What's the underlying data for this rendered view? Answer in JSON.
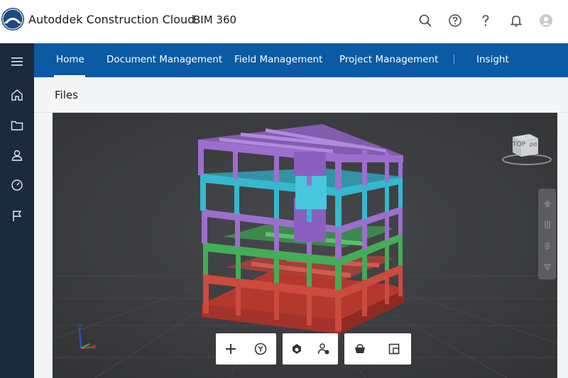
{
  "header": {
    "brand": "Autoddek Construction Cloud",
    "product": "BIM 360",
    "icons": [
      "search-icon",
      "help-circle-icon",
      "question-icon",
      "bell-icon",
      "user-avatar-icon"
    ]
  },
  "sidebar": {
    "icons": [
      "menu-icon",
      "home-icon",
      "folder-icon",
      "user-icon",
      "gauge-icon",
      "flag-icon"
    ]
  },
  "nav": {
    "items": [
      {
        "label": "Home"
      },
      {
        "label": "Document Management"
      },
      {
        "label": "Field Management"
      },
      {
        "label": "Project Management"
      },
      {
        "label": "Insight"
      }
    ],
    "active": "Home"
  },
  "page": {
    "title": "Files"
  },
  "viewer": {
    "viewcube_label": "TOP",
    "viewcube_side": "pd",
    "axis_labels": {
      "z": "Z",
      "x": "X"
    },
    "toolbar_groups": [
      [
        "plus-icon",
        "y-circle-icon"
      ],
      [
        "section-icon",
        "person-settings-icon"
      ],
      [
        "basket-icon",
        "layout-icon"
      ]
    ],
    "side_tools": [
      "orbit-icon",
      "pan-icon",
      "zoom-icon",
      "fit-icon"
    ]
  },
  "colors": {
    "topbar": "#ffffff",
    "sidebar": "#1b2a3d",
    "nav": "#0b5aa3",
    "viewer_bg": "#3c3d3f",
    "floor_purple": "#9468c8",
    "floor_cyan": "#33b6cc",
    "floor_green": "#3fa855",
    "floor_red": "#c8453a"
  }
}
